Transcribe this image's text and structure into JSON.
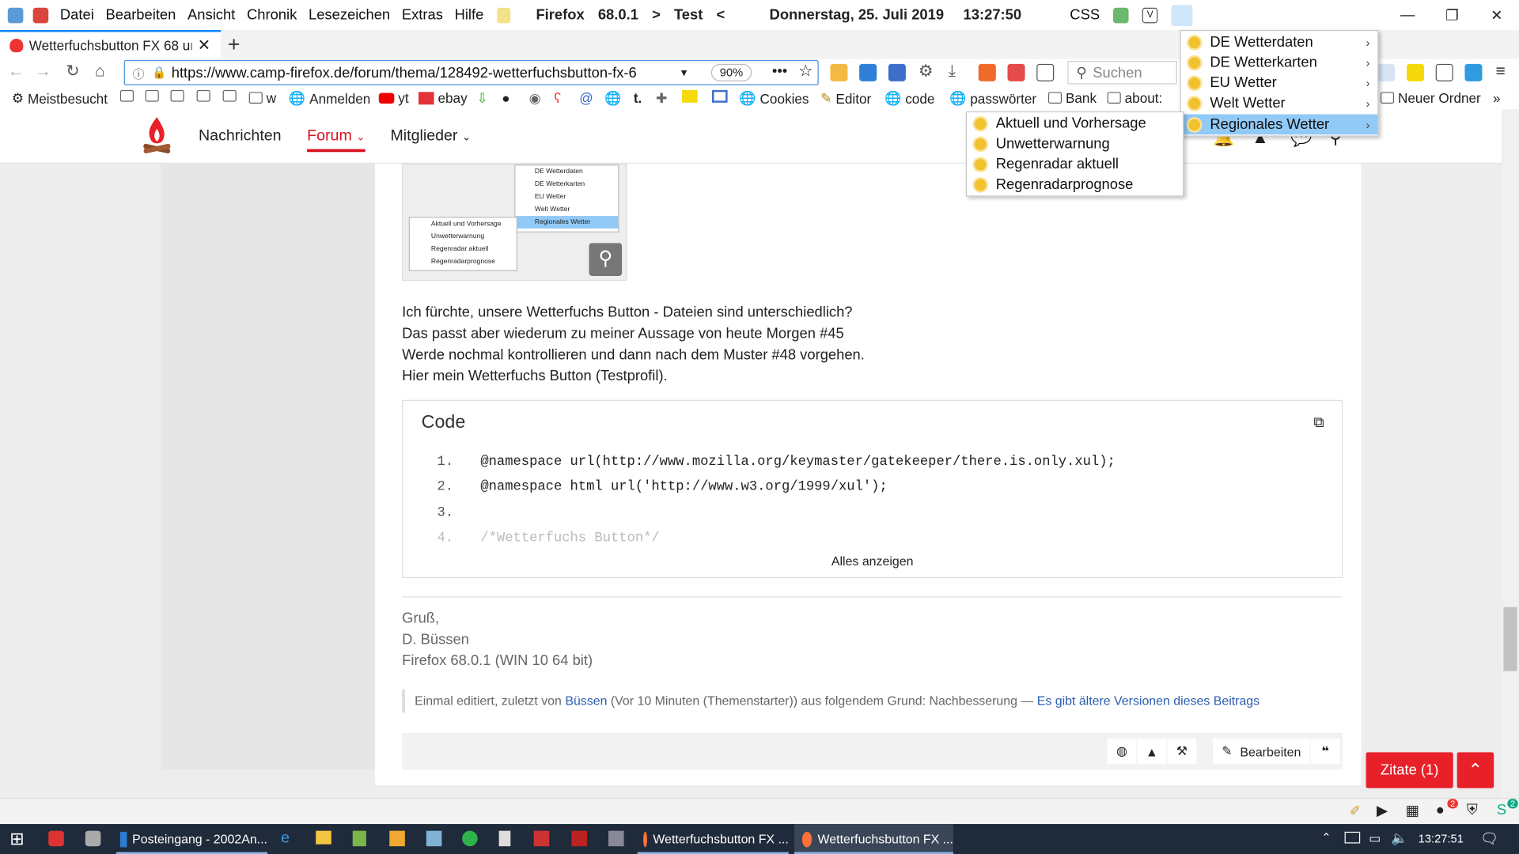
{
  "menubar": {
    "items": [
      "Datei",
      "Bearbeiten",
      "Ansicht",
      "Chronik",
      "Lesezeichen",
      "Extras",
      "Hilfe"
    ],
    "title_browser": "Firefox",
    "title_version": "68.0.1",
    "title_arrow_left": ">",
    "title_profile": "Test",
    "title_arrow_right": "<",
    "date": "Donnerstag, 25. Juli 2019",
    "time": "13:27:50",
    "css_label": "CSS"
  },
  "tab": {
    "title": "Wetterfuchsbutton FX 68 ur"
  },
  "urlbar": {
    "url": "https://www.camp-firefox.de/forum/thema/128492-wetterfuchsbutton-fx-6",
    "zoom": "90%",
    "search_placeholder": "Suchen"
  },
  "bookmarks": {
    "meistbesucht": "Meistbesucht",
    "w": "w",
    "anmelden": "Anmelden",
    "yt": "yt",
    "ebay": "ebay",
    "t": "t.",
    "cookies": "Cookies",
    "editor": "Editor",
    "code": "code",
    "passwoerter": "passwörter",
    "bank": "Bank",
    "about": "about:",
    "neuer_ordner": "Neuer Ordner"
  },
  "site_nav": {
    "nachrichten": "Nachrichten",
    "forum": "Forum",
    "mitglieder": "Mitglieder"
  },
  "thumb_menu": {
    "right": [
      "DE Wetterdaten",
      "DE Wetterkarten",
      "EU Wetter",
      "Welt Wetter",
      "Regionales Wetter"
    ],
    "left": [
      "Aktuell und Vorhersage",
      "Unwetterwarnung",
      "Regenradar aktuell",
      "Regenradarprognose"
    ]
  },
  "post": {
    "lines": [
      "Ich fürchte, unsere Wetterfuchs Button - Dateien sind unterschiedlich?",
      "Das passt aber wiederum zu meiner Aussage von heute Morgen #45",
      "Werde nochmal kontrollieren und dann nach dem Muster #48 vorgehen.",
      "Hier mein Wetterfuchs Button (Testprofil)."
    ]
  },
  "code": {
    "title": "Code",
    "lines": [
      {
        "num": "1.",
        "text": "@namespace url(http://www.mozilla.org/keymaster/gatekeeper/there.is.only.xul);"
      },
      {
        "num": "2.",
        "text": "@namespace html url('http://www.w3.org/1999/xul');"
      },
      {
        "num": "3.",
        "text": ""
      },
      {
        "num": "4.",
        "text": "/*Wetterfuchs Button*/"
      }
    ],
    "show_all": "Alles anzeigen"
  },
  "signature": {
    "greeting": "Gruß,",
    "name": "D. Büssen",
    "system": "Firefox 68.0.1 (WIN 10 64 bit)"
  },
  "edit_note": {
    "prefix": "Einmal editiert, zuletzt von",
    "user": "Büssen",
    "reason": "(Vor 10 Minuten (Themenstarter)) aus folgendem Grund: Nachbesserung —",
    "link": "Es gibt ältere Versionen dieses Beitrags"
  },
  "footer": {
    "edit": "Bearbeiten",
    "quote_icon": "❝"
  },
  "zitate": "Zitate (1)",
  "dropdown": {
    "main": [
      "DE Wetterdaten",
      "DE Wetterkarten",
      "EU Wetter",
      "Welt Wetter",
      "Regionales Wetter"
    ],
    "sub": [
      "Aktuell und Vorhersage",
      "Unwetterwarnung",
      "Regenradar aktuell",
      "Regenradarprognose"
    ]
  },
  "taskbar": {
    "apps": [
      "Posteingang - 2002An...",
      "Wetterfuchsbutton FX ...",
      "Wetterfuchsbutton FX ..."
    ],
    "time": "13:27:51",
    "badge_red": "2",
    "badge_green": "2"
  },
  "colors": {
    "accent": "#d7121f",
    "button_red": "#e8202a",
    "menu_highlight": "#91c9f7",
    "focus": "#0a84ff"
  }
}
